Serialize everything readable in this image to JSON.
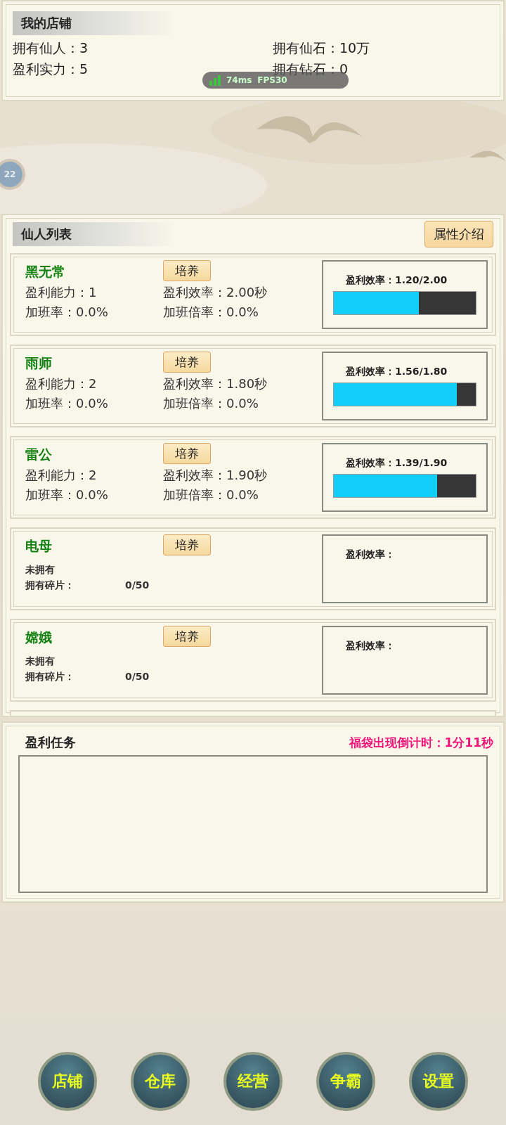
{
  "shop": {
    "title": "我的店铺",
    "stats": [
      {
        "label": "拥有仙人：",
        "value": "3"
      },
      {
        "label": "拥有仙石：",
        "value": "10万"
      },
      {
        "label": "盈利实力：",
        "value": "5"
      },
      {
        "label": "拥有钻石：",
        "value": "0"
      }
    ]
  },
  "overlay": {
    "ping": "74ms",
    "fps": "FPS30"
  },
  "avatar_badge": "22",
  "immortals": {
    "title": "仙人列表",
    "info_button": "属性介绍",
    "rows": [
      {
        "kind": "owned",
        "name": "黑无常",
        "train": "培养",
        "ability": "盈利能力：1",
        "efficiency": "盈利效率：2.00秒",
        "ot_rate": "加班率：0.0%",
        "ot_mult": "加班倍率：0.0%",
        "meter_label": "盈利效率：1.20/2.00",
        "level": 0.6
      },
      {
        "kind": "owned",
        "name": "雨师",
        "train": "培养",
        "ability": "盈利能力：2",
        "efficiency": "盈利效率：1.80秒",
        "ot_rate": "加班率：0.0%",
        "ot_mult": "加班倍率：0.0%",
        "meter_label": "盈利效率：1.56/1.80",
        "level": 0.867
      },
      {
        "kind": "owned",
        "name": "雷公",
        "train": "培养",
        "ability": "盈利能力：2",
        "efficiency": "盈利效率：1.90秒",
        "ot_rate": "加班率：0.0%",
        "ot_mult": "加班倍率：0.0%",
        "meter_label": "盈利效率：1.39/1.90",
        "level": 0.73
      },
      {
        "kind": "locked",
        "name": "电母",
        "train": "培养",
        "status": "未拥有",
        "shards_label": "拥有碎片：",
        "shards": "0/50",
        "meter_label": "盈利效率："
      },
      {
        "kind": "locked",
        "name": "嫦娥",
        "train": "培养",
        "status": "未拥有",
        "shards_label": "拥有碎片：",
        "shards": "0/50",
        "meter_label": "盈利效率："
      }
    ]
  },
  "tasks": {
    "title": "盈利任务",
    "countdown": "福袋出现倒计时：1分11秒"
  },
  "nav": [
    "店铺",
    "仓库",
    "经营",
    "争霸",
    "设置"
  ]
}
